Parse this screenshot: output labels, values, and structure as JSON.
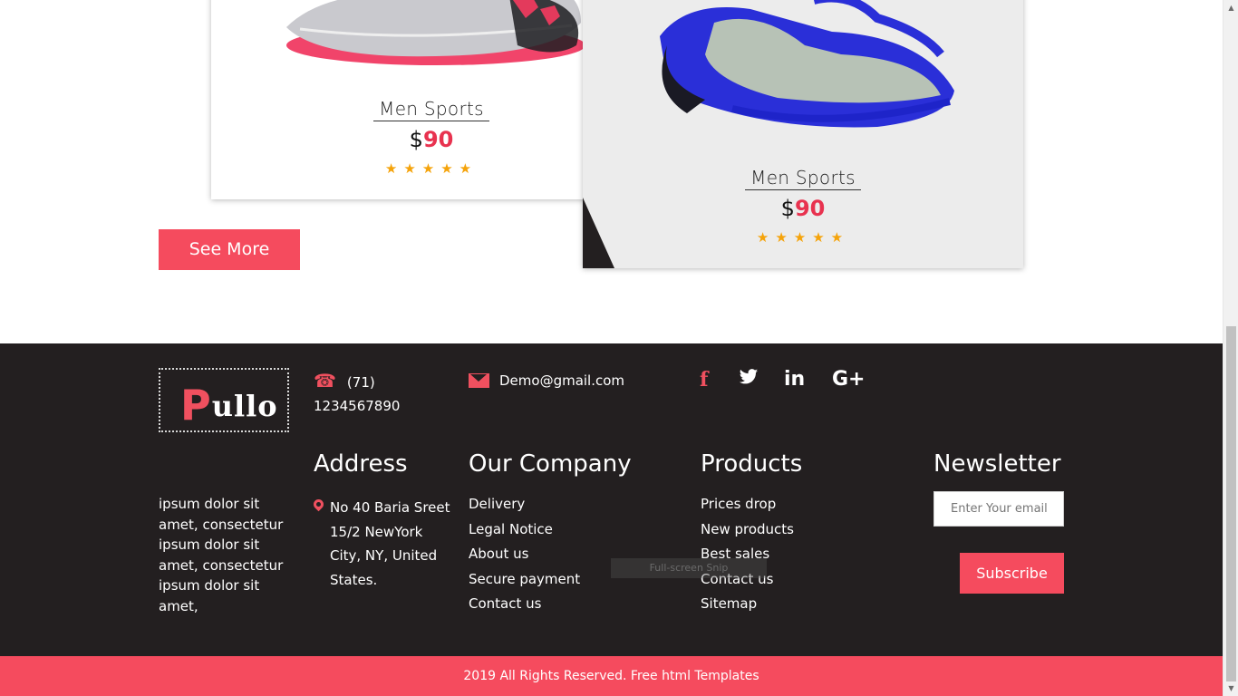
{
  "products": [
    {
      "name": "Men Sports",
      "currency": "$",
      "price": "90",
      "rating": 5
    },
    {
      "name": "Men Sports",
      "currency": "$",
      "price": "90",
      "rating": 5
    }
  ],
  "stars_text": "★★★★★",
  "see_more_label": "See More",
  "footer": {
    "logo": {
      "first_letter": "P",
      "rest": "ullo"
    },
    "phone": {
      "icon": "phone-icon",
      "area": "(71)",
      "number": "1234567890"
    },
    "email": {
      "icon": "envelope-icon",
      "address": "Demo@gmail.com"
    },
    "social": [
      {
        "icon": "facebook-icon",
        "glyph": "f"
      },
      {
        "icon": "twitter-icon",
        "glyph": "🐦"
      },
      {
        "icon": "linkedin-icon",
        "glyph": "in"
      },
      {
        "icon": "google-plus-icon",
        "glyph": "G+"
      }
    ],
    "about_text": "ipsum dolor sit amet, consectetur ipsum dolor sit amet, consectetur ipsum dolor sit amet,",
    "address": {
      "title": "Address",
      "text": "No 40 Baria Sreet 15/2 NewYork City, NY, United States."
    },
    "company": {
      "title": "Our Company",
      "links": [
        "Delivery",
        "Legal Notice",
        "About us",
        "Secure payment",
        "Contact us"
      ]
    },
    "products": {
      "title": "Products",
      "links": [
        "Prices drop",
        "New products",
        "Best sales",
        "Contact us",
        "Sitemap"
      ]
    },
    "newsletter": {
      "title": "Newsletter",
      "placeholder": "Enter Your email",
      "button_label": "Subscribe"
    },
    "overlay_text": "Full-screen Snip",
    "copyright": "2019 All Rights Reserved. Free html Templates"
  },
  "colors": {
    "accent": "#f54b5e",
    "price": "#e8324f",
    "star": "#f5a30a",
    "footer_bg": "#231f20"
  }
}
